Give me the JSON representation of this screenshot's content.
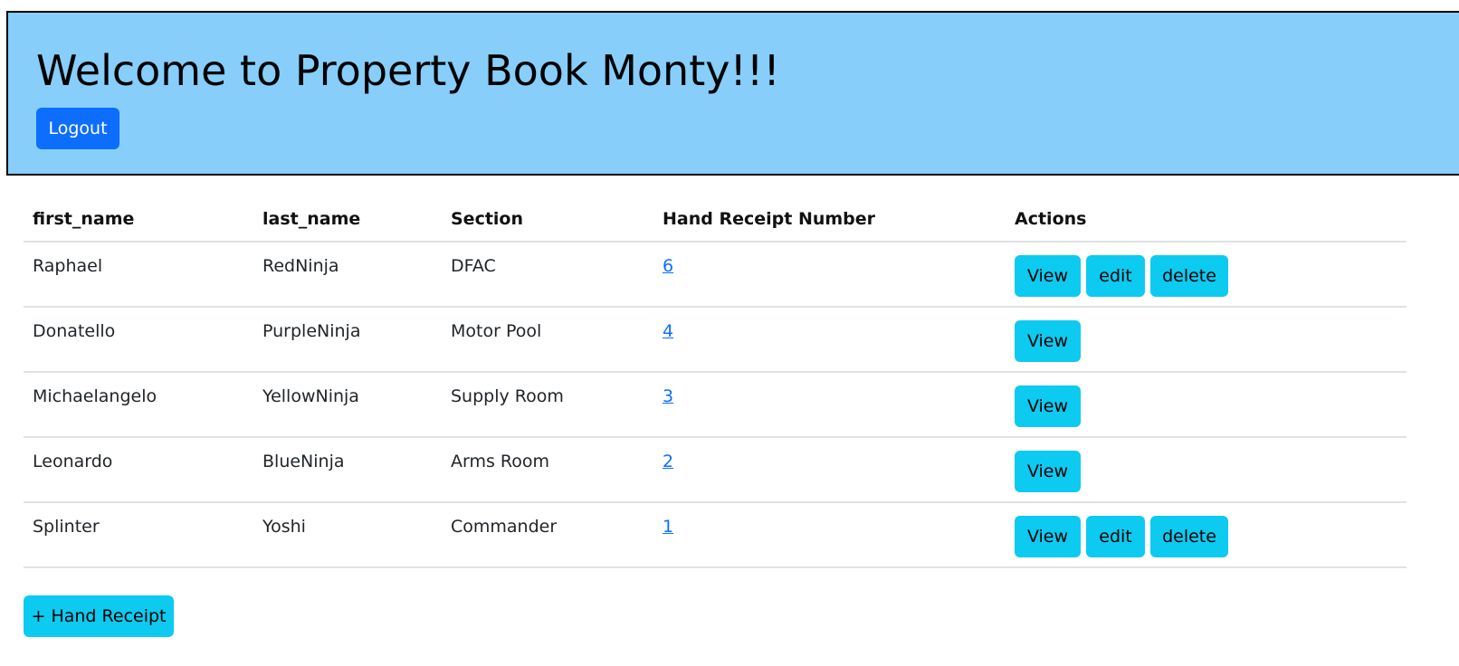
{
  "header": {
    "title": "Welcome to Property Book Monty!!!",
    "logout_label": "Logout"
  },
  "table": {
    "columns": [
      "first_name",
      "last_name",
      "Section",
      "Hand Receipt Number",
      "Actions"
    ],
    "rows": [
      {
        "first_name": "Raphael",
        "last_name": "RedNinja",
        "section": "DFAC",
        "hand_receipt_number": "6",
        "actions": {
          "view": "View",
          "edit": "edit",
          "delete": "delete"
        }
      },
      {
        "first_name": "Donatello",
        "last_name": "PurpleNinja",
        "section": "Motor Pool",
        "hand_receipt_number": "4",
        "actions": {
          "view": "View"
        }
      },
      {
        "first_name": "Michaelangelo",
        "last_name": "YellowNinja",
        "section": "Supply Room",
        "hand_receipt_number": "3",
        "actions": {
          "view": "View"
        }
      },
      {
        "first_name": "Leonardo",
        "last_name": "BlueNinja",
        "section": "Arms Room",
        "hand_receipt_number": "2",
        "actions": {
          "view": "View"
        }
      },
      {
        "first_name": "Splinter",
        "last_name": "Yoshi",
        "section": "Commander",
        "hand_receipt_number": "1",
        "actions": {
          "view": "View",
          "edit": "edit",
          "delete": "delete"
        }
      }
    ]
  },
  "add_button_label": "+ Hand Receipt",
  "colors": {
    "banner_bg": "#87cefa",
    "primary": "#0d6efd",
    "info": "#0dcaf0"
  }
}
